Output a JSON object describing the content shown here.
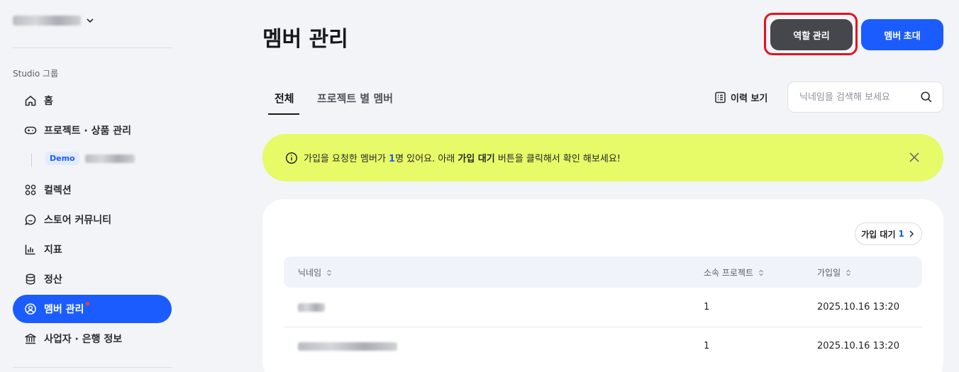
{
  "sidebar": {
    "group_label": "Studio 그룹",
    "items": [
      {
        "label": "홈",
        "icon": "home-icon"
      },
      {
        "label": "프로젝트 · 상품 관리",
        "icon": "gamepad-icon"
      },
      {
        "label": "컬렉션",
        "icon": "grid-icon"
      },
      {
        "label": "스토어 커뮤니티",
        "icon": "chat-icon"
      },
      {
        "label": "지표",
        "icon": "bar-chart-icon"
      },
      {
        "label": "정산",
        "icon": "database-icon"
      },
      {
        "label": "멤버 관리",
        "icon": "user-circle-icon",
        "active": true
      },
      {
        "label": "사업자 · 은행 정보",
        "icon": "bank-icon"
      }
    ],
    "sub_badge": "Demo"
  },
  "header": {
    "title": "멤버 관리",
    "role_button": "역할 관리",
    "invite_button": "멤버 초대"
  },
  "tabs": [
    "전체",
    "프로젝트 별 멤버"
  ],
  "history_label": "이력 보기",
  "search": {
    "placeholder": "닉네임을 검색해 보세요"
  },
  "banner": {
    "pre": "가입을 요청한 멤버가 ",
    "count": "1",
    "mid": "명 있어요. 아래 ",
    "bold": "가입 대기",
    "post": " 버튼을 클릭해서 확인 해보세요!"
  },
  "pending": {
    "label": "가입 대기",
    "count": "1"
  },
  "table": {
    "headers": [
      "닉네임",
      "소속 프로젝트",
      "가입일"
    ],
    "rows": [
      {
        "projects": "1",
        "joined": "2025.10.16 13:20"
      },
      {
        "projects": "1",
        "joined": "2025.10.16 13:20"
      }
    ]
  },
  "colors": {
    "accent": "#1a5cff",
    "banner": "#e6fb67",
    "role_button": "#45474c",
    "highlight": "#e3131c"
  }
}
